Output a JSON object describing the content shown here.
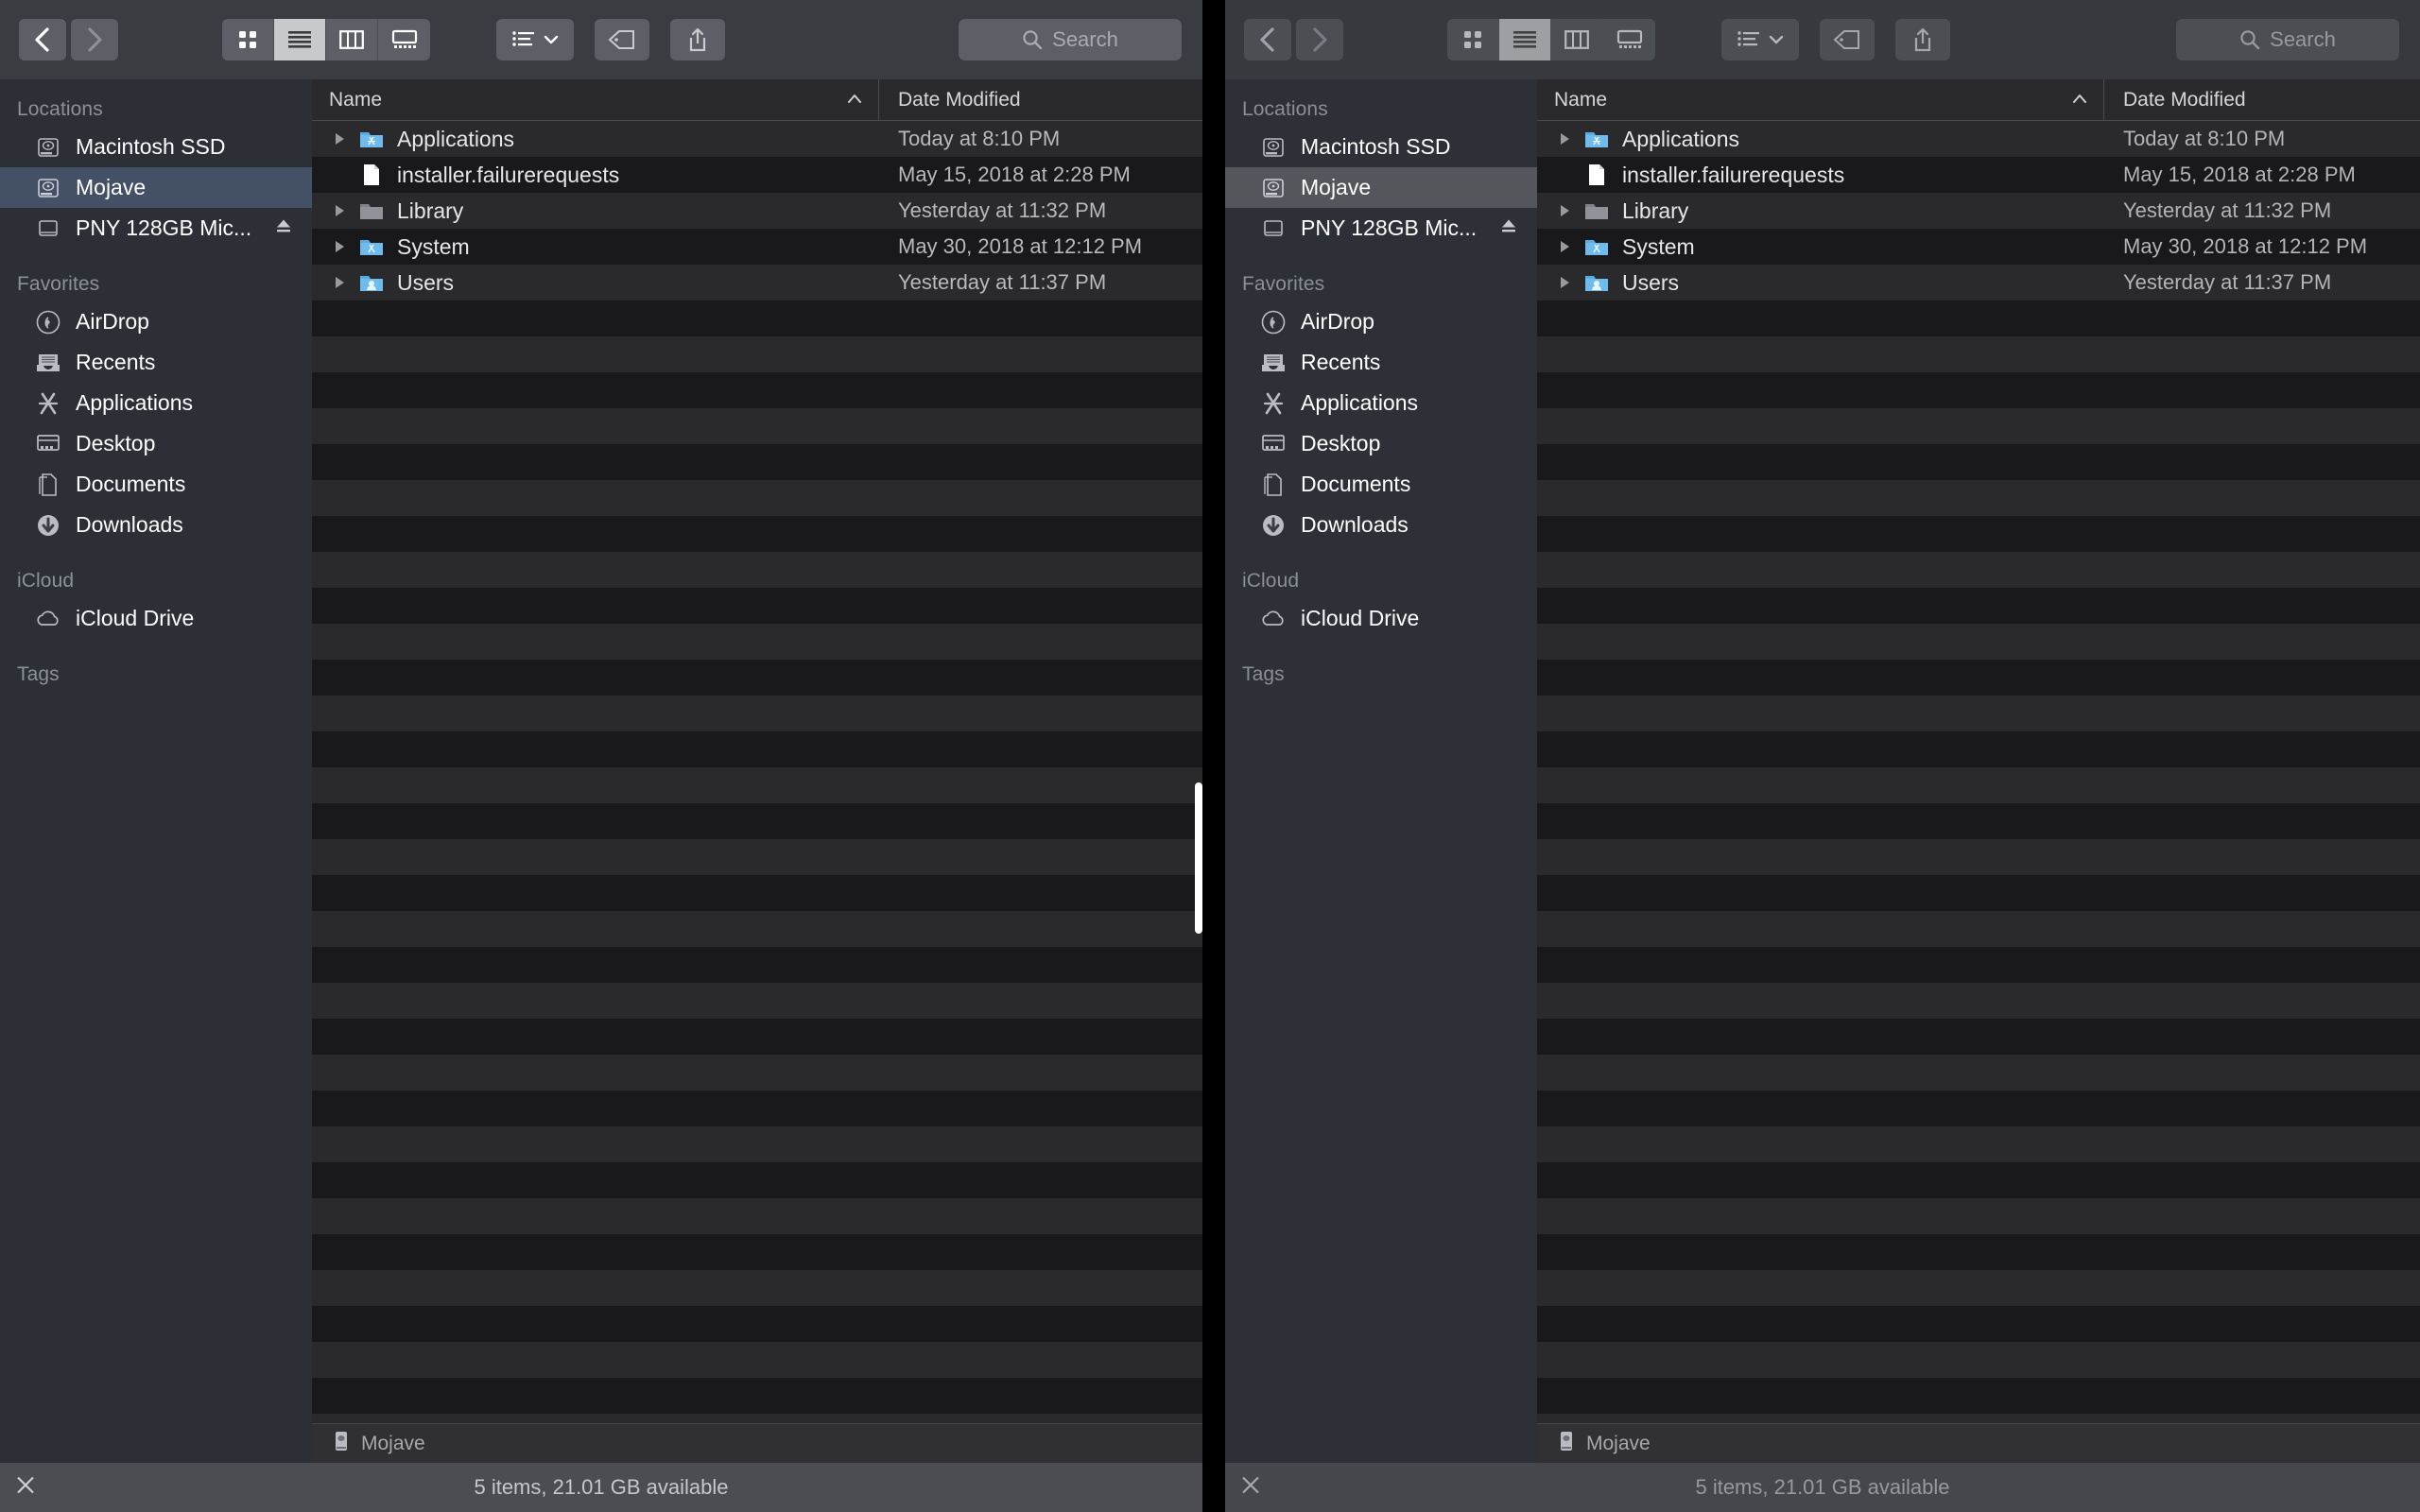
{
  "window": {
    "toolbar": {
      "back_label": "Back",
      "forward_label": "Forward",
      "view_icon_grid": "grid-view-icon",
      "view_icon_list": "list-view-icon",
      "view_icon_column": "column-view-icon",
      "view_icon_gallery": "gallery-view-icon",
      "arrange_label": "Arrange",
      "tag_label": "Tags",
      "share_label": "Share",
      "search_placeholder": "Search"
    },
    "sidebar": {
      "sections": [
        {
          "title": "Locations",
          "items": [
            {
              "label": "Macintosh SSD",
              "icon": "hard-disk-icon",
              "selected": false,
              "eject": false
            },
            {
              "label": "Mojave",
              "icon": "hard-disk-icon",
              "selected": true,
              "eject": false
            },
            {
              "label": "PNY 128GB Mic...",
              "icon": "external-drive-icon",
              "selected": false,
              "eject": true
            }
          ]
        },
        {
          "title": "Favorites",
          "items": [
            {
              "label": "AirDrop",
              "icon": "airdrop-icon",
              "selected": false,
              "eject": false
            },
            {
              "label": "Recents",
              "icon": "recents-icon",
              "selected": false,
              "eject": false
            },
            {
              "label": "Applications",
              "icon": "applications-icon",
              "selected": false,
              "eject": false
            },
            {
              "label": "Desktop",
              "icon": "desktop-icon",
              "selected": false,
              "eject": false
            },
            {
              "label": "Documents",
              "icon": "documents-icon",
              "selected": false,
              "eject": false
            },
            {
              "label": "Downloads",
              "icon": "downloads-icon",
              "selected": false,
              "eject": false
            }
          ]
        },
        {
          "title": "iCloud",
          "items": [
            {
              "label": "iCloud Drive",
              "icon": "cloud-icon",
              "selected": false,
              "eject": false
            }
          ]
        },
        {
          "title": "Tags",
          "items": []
        }
      ]
    },
    "list": {
      "columns": {
        "name": "Name",
        "date_modified": "Date Modified"
      },
      "sort_indicator": "ascending",
      "rows": [
        {
          "name": "Applications",
          "date": "Today at 8:10 PM",
          "icon": "applications-folder-icon",
          "disclosure": true
        },
        {
          "name": "installer.failurerequests",
          "date": "May 15, 2018 at 2:28 PM",
          "icon": "document-file-icon",
          "disclosure": false
        },
        {
          "name": "Library",
          "date": "Yesterday at 11:32 PM",
          "icon": "library-folder-icon",
          "disclosure": true
        },
        {
          "name": "System",
          "date": "May 30, 2018 at 12:12 PM",
          "icon": "system-folder-icon",
          "disclosure": true
        },
        {
          "name": "Users",
          "date": "Yesterday at 11:37 PM",
          "icon": "users-folder-icon",
          "disclosure": true
        }
      ]
    },
    "pathbar": {
      "current": "Mojave",
      "icon": "drive-icon"
    },
    "statusbar": {
      "text": "5 items, 21.01 GB available",
      "left_icon": "x-icon"
    }
  },
  "colors": {
    "selection_active": "#435066",
    "selection_inactive": "#54565b",
    "sidebar_bg": "#2c3036",
    "list_bg": "#2a2a2c",
    "list_alt_bg": "#19191b",
    "toolbar_bg": "#393c41",
    "status_bg": "#4b4d52",
    "folder_blue": "#5aade4"
  }
}
